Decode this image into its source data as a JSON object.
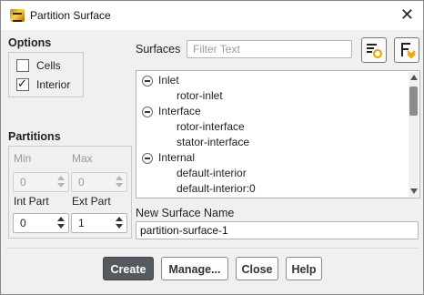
{
  "window": {
    "title": "Partition Surface",
    "close_glyph": "✕"
  },
  "options": {
    "heading": "Options",
    "cells": {
      "label": "Cells",
      "checked": false
    },
    "interior": {
      "label": "Interior",
      "checked": true
    }
  },
  "partitions": {
    "heading": "Partitions",
    "min": {
      "label": "Min",
      "value": "0",
      "enabled": false
    },
    "max": {
      "label": "Max",
      "value": "0",
      "enabled": false
    },
    "int_part": {
      "label": "Int Part",
      "value": "0"
    },
    "ext_part": {
      "label": "Ext Part",
      "value": "1"
    }
  },
  "surfaces": {
    "label": "Surfaces",
    "filter_placeholder": "Filter Text",
    "groups": [
      {
        "name": "Inlet",
        "items": [
          "rotor-inlet"
        ]
      },
      {
        "name": "Interface",
        "items": [
          "rotor-interface",
          "stator-interface"
        ]
      },
      {
        "name": "Internal",
        "items": [
          "default-interior",
          "default-interior:0"
        ]
      }
    ]
  },
  "new_surface": {
    "label": "New Surface Name",
    "value": "partition-surface-1"
  },
  "buttons": {
    "create": "Create",
    "manage": "Manage...",
    "close": "Close",
    "help": "Help"
  },
  "icons": {
    "app": "fluent-app-icon",
    "filter_tool": "filter-list-icon",
    "select_tool": "select-all-icon"
  },
  "colors": {
    "primary_button": "#555a60",
    "icon_accent": "#f0a000"
  }
}
